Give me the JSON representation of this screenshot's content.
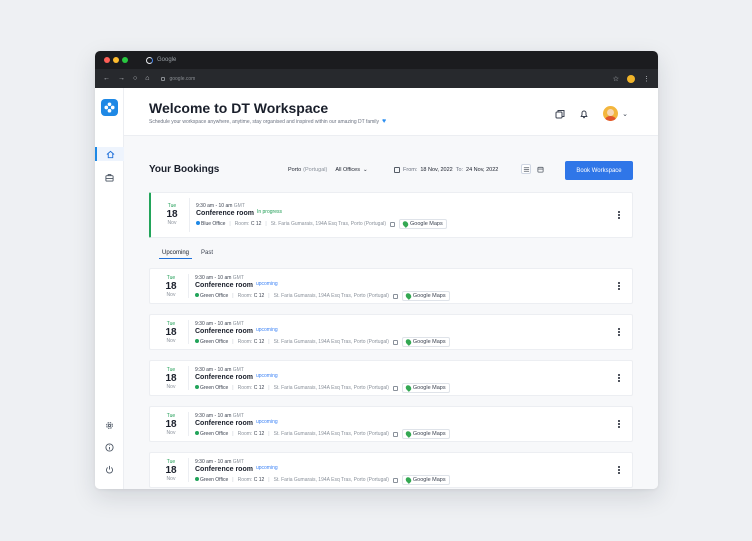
{
  "browser": {
    "tab_title": "Google",
    "url": "google.com",
    "traffic_lights": [
      "#ff5f57",
      "#febc2e",
      "#28c840"
    ]
  },
  "colors": {
    "accent": "#2f76e8",
    "in_progress": "#1f9d55",
    "upcoming": "#3b82f6",
    "blue_office": "#1e88e5",
    "green_office": "#22a45a"
  },
  "sidebar": {
    "items": [
      {
        "name": "home-icon",
        "active": true
      },
      {
        "name": "briefcase-icon",
        "active": false
      }
    ],
    "bottom_items": [
      {
        "name": "gear-icon"
      },
      {
        "name": "info-icon"
      },
      {
        "name": "power-icon"
      }
    ]
  },
  "header": {
    "title": "Welcome to DT Workspace",
    "subtitle": "Schedule your workspace anywhere, anytime, stay organised and inspired within our amazing DT family"
  },
  "toolbar": {
    "title": "Your Bookings",
    "city": "Porto",
    "country": "(Portugal)",
    "offices": "All Offices",
    "from_label": "From:",
    "from_date": "18 Nov, 2022",
    "to_label": "To:",
    "to_date": "24 Nov, 2022",
    "book_button": "Book Workspace"
  },
  "tabs": [
    {
      "label": "Upcoming",
      "active": true
    },
    {
      "label": "Past",
      "active": false
    }
  ],
  "current_booking": {
    "day": "Tue",
    "date": "18",
    "month": "Nov",
    "time": "9:30 am - 10 am",
    "tz": "GMT",
    "room": "Conference room",
    "status": "In progress",
    "office": "Blue Office",
    "room_label": "Room:",
    "room_code": "C 12",
    "address": "St. Faria Gumarais, 194A Esq Tras, Porto (Portugal)",
    "maps_label": "Google Maps"
  },
  "upcoming_bookings": [
    {
      "day": "Tue",
      "date": "18",
      "month": "Nov",
      "time": "9:30 am - 10 am",
      "tz": "GMT",
      "room": "Conference room",
      "status": "upcoming",
      "office": "Green Office",
      "room_label": "Room:",
      "room_code": "C 12",
      "address": "St. Faria Gumarais, 194A Esq Tras, Porto (Portugal)",
      "maps_label": "Google Maps"
    },
    {
      "day": "Tue",
      "date": "18",
      "month": "Nov",
      "time": "9:30 am - 10 am",
      "tz": "GMT",
      "room": "Conference room",
      "status": "upcoming",
      "office": "Green Office",
      "room_label": "Room:",
      "room_code": "C 12",
      "address": "St. Faria Gumarais, 194A Esq Tras, Porto (Portugal)",
      "maps_label": "Google Maps"
    },
    {
      "day": "Tue",
      "date": "18",
      "month": "Nov",
      "time": "9:30 am - 10 am",
      "tz": "GMT",
      "room": "Conference room",
      "status": "upcoming",
      "office": "Green Office",
      "room_label": "Room:",
      "room_code": "C 12",
      "address": "St. Faria Gumarais, 194A Esq Tras, Porto (Portugal)",
      "maps_label": "Google Maps"
    },
    {
      "day": "Tue",
      "date": "18",
      "month": "Nov",
      "time": "9:30 am - 10 am",
      "tz": "GMT",
      "room": "Conference room",
      "status": "upcoming",
      "office": "Green Office",
      "room_label": "Room:",
      "room_code": "C 12",
      "address": "St. Faria Gumarais, 194A Esq Tras, Porto (Portugal)",
      "maps_label": "Google Maps"
    },
    {
      "day": "Tue",
      "date": "18",
      "month": "Nov",
      "time": "9:30 am - 10 am",
      "tz": "GMT",
      "room": "Conference room",
      "status": "upcoming",
      "office": "Green Office",
      "room_label": "Room:",
      "room_code": "C 12",
      "address": "St. Faria Gumarais, 194A Esq Tras, Porto (Portugal)",
      "maps_label": "Google Maps"
    }
  ]
}
